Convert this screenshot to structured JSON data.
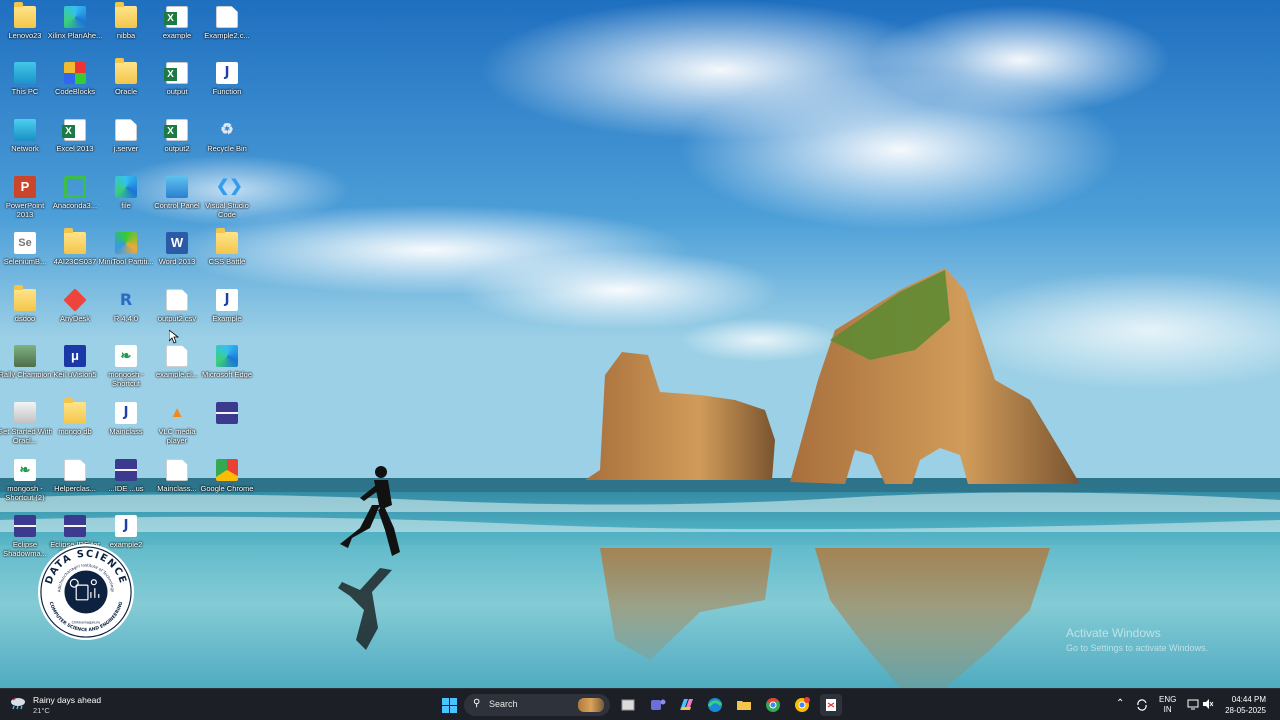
{
  "desktop": {
    "icons": [
      {
        "label": "Lenovo23",
        "icon": "folder-icon"
      },
      {
        "label": "Xilinx PlanAhe...",
        "icon": "xilinx-icon"
      },
      {
        "label": "nibba",
        "icon": "folder-icon"
      },
      {
        "label": "example",
        "icon": "excel-icon"
      },
      {
        "label": "Example2.c...",
        "icon": "document-icon"
      },
      {
        "label": "This PC",
        "icon": "this-pc-icon"
      },
      {
        "label": "CodeBlocks",
        "icon": "codeblocks-icon"
      },
      {
        "label": "Oracle",
        "icon": "folder-icon"
      },
      {
        "label": "output",
        "icon": "excel-icon"
      },
      {
        "label": "Function",
        "icon": "java-icon"
      },
      {
        "label": "Network",
        "icon": "network-icon"
      },
      {
        "label": "Excel 2013",
        "icon": "excel-icon"
      },
      {
        "label": "j.server",
        "icon": "document-icon"
      },
      {
        "label": "output2",
        "icon": "excel-icon"
      },
      {
        "label": "Recycle Bin",
        "icon": "recycle-bin-icon"
      },
      {
        "label": "PowerPoint 2013",
        "icon": "powerpoint-icon"
      },
      {
        "label": "Anaconda3...",
        "icon": "anaconda-icon"
      },
      {
        "label": "file",
        "icon": "edge-icon"
      },
      {
        "label": "Control Panel",
        "icon": "control-panel-icon"
      },
      {
        "label": "Visual Studio Code",
        "icon": "vscode-icon"
      },
      {
        "label": "SeleniumB...",
        "icon": "selenium-icon"
      },
      {
        "label": "4AI23CS037",
        "icon": "folder-icon"
      },
      {
        "label": "MiniTool Partiti...",
        "icon": "minitool-icon"
      },
      {
        "label": "Word 2013",
        "icon": "word-icon"
      },
      {
        "label": "CSS Battle",
        "icon": "folder-icon"
      },
      {
        "label": "dsdoo",
        "icon": "folder-icon"
      },
      {
        "label": "AnyDesk",
        "icon": "anydesk-icon"
      },
      {
        "label": "R 4.4.0",
        "icon": "r-icon"
      },
      {
        "label": "output2.csv",
        "icon": "document-icon"
      },
      {
        "label": "Example",
        "icon": "java-icon"
      },
      {
        "label": "Rally Champion",
        "icon": "rally-icon"
      },
      {
        "label": "Keil uVision5",
        "icon": "keil-icon"
      },
      {
        "label": "mongosh - Shortcut",
        "icon": "mongodb-icon"
      },
      {
        "label": "example.cl...",
        "icon": "document-icon"
      },
      {
        "label": "Microsoft Edge",
        "icon": "edge-icon"
      },
      {
        "label": "Get Started With Oracl...",
        "icon": "oracle-db-icon"
      },
      {
        "label": "mongo db",
        "icon": "folder-icon"
      },
      {
        "label": "Mainclass",
        "icon": "java-icon"
      },
      {
        "label": "VLC media player",
        "icon": "vlc-icon"
      },
      {
        "label": "",
        "icon": "eclipse-icon"
      },
      {
        "label": "mongosh - Shortcut (2)",
        "icon": "mongodb-icon"
      },
      {
        "label": "Helperclas...",
        "icon": "document-icon"
      },
      {
        "label": "...IDE ...us",
        "icon": "eclipse-icon"
      },
      {
        "label": "Mainclass...",
        "icon": "document-icon"
      },
      {
        "label": "Google Chrome",
        "icon": "chrome-icon"
      },
      {
        "label": "Eclipse Shadowma...",
        "icon": "eclipse-icon"
      },
      {
        "label": "Eclipse IDE for Java De...",
        "icon": "eclipse-icon"
      },
      {
        "label": "example2",
        "icon": "java-icon"
      }
    ]
  },
  "logo": {
    "top_text": "DATA SCIENCE",
    "inner_text": "Adichunchanagiri Institute of Technology",
    "bottom_text": "COMPUTER SCIENCE AND ENGINEERING",
    "city": "Chikkamagaluru"
  },
  "activation": {
    "title": "Activate Windows",
    "subtitle": "Go to Settings to activate Windows."
  },
  "taskbar": {
    "weather_title": "Rainy days ahead",
    "weather_temp": "21°C",
    "search_placeholder": "Search",
    "language": "ENG",
    "region": "IN",
    "time": "04:44 PM",
    "date": "28-05-2025",
    "apps": [
      "file-explorer-alt-icon",
      "teams-icon",
      "copilot-icon",
      "edge-icon",
      "file-explorer-icon",
      "chrome-icon",
      "chrome-profile-icon",
      "snipping-tool-icon"
    ]
  },
  "colors": {
    "taskbar_bg": "#1c1f26",
    "accent": "#4cc2ff",
    "sky_top": "#1f6fc0",
    "sea": "#3aa3b8"
  }
}
